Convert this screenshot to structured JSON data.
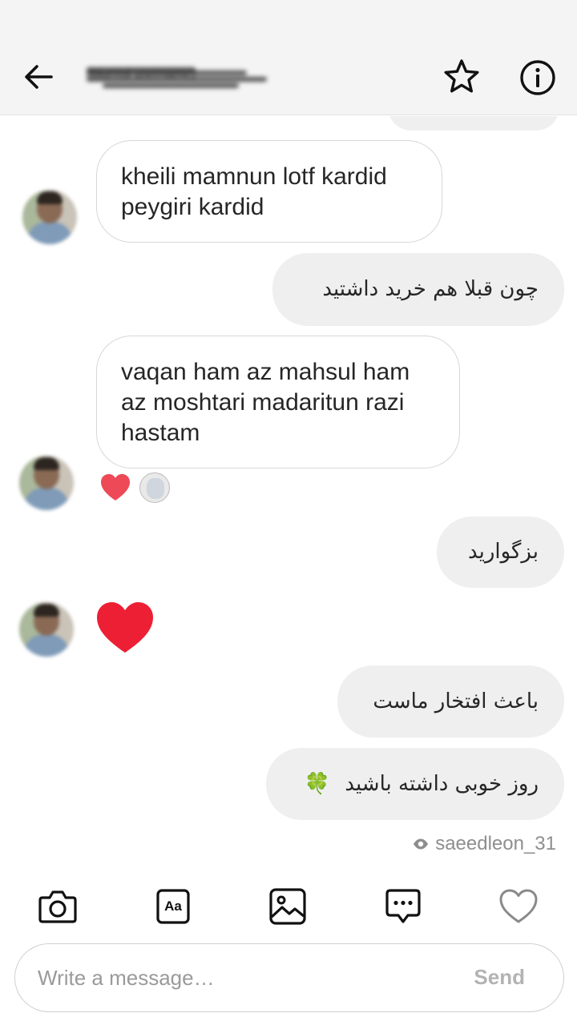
{
  "header": {
    "title": "(blurred username)",
    "back_icon": "arrow-left-icon",
    "star_icon": "star-icon",
    "info_icon": "info-icon"
  },
  "messages": [
    {
      "direction": "incoming",
      "lines": [
        "kheili mamnun lotf kardid",
        "peygiri kardid"
      ]
    },
    {
      "direction": "outgoing",
      "text": "چون قبلا هم خرید داشتید"
    },
    {
      "direction": "incoming",
      "lines": [
        "vaqan ham az mahsul ham",
        "az moshtari madaritun razi",
        "hastam"
      ],
      "reactions": [
        "heart",
        "avatar"
      ]
    },
    {
      "direction": "outgoing",
      "text": "بزگوارید"
    },
    {
      "direction": "incoming",
      "type": "heart"
    },
    {
      "direction": "outgoing",
      "text": "باعث افتخار ماست"
    },
    {
      "direction": "outgoing",
      "text": "روز خوبی داشته باشید",
      "emoji": "🍀"
    }
  ],
  "seen": {
    "label": "saeedleon_31",
    "icon": "eye-icon"
  },
  "toolbar": {
    "icons": [
      "camera-icon",
      "text-style-icon",
      "gallery-icon",
      "message-options-icon",
      "heart-icon"
    ],
    "text_style_label": "Aa"
  },
  "composer": {
    "placeholder": "Write a message…",
    "send_label": "Send"
  },
  "colors": {
    "header_bg": "#f4f4f4",
    "outgoing_bubble": "#efefef",
    "incoming_border": "#d7d7d7",
    "heart": "#ed4956",
    "muted_text": "#8e8e8e"
  }
}
